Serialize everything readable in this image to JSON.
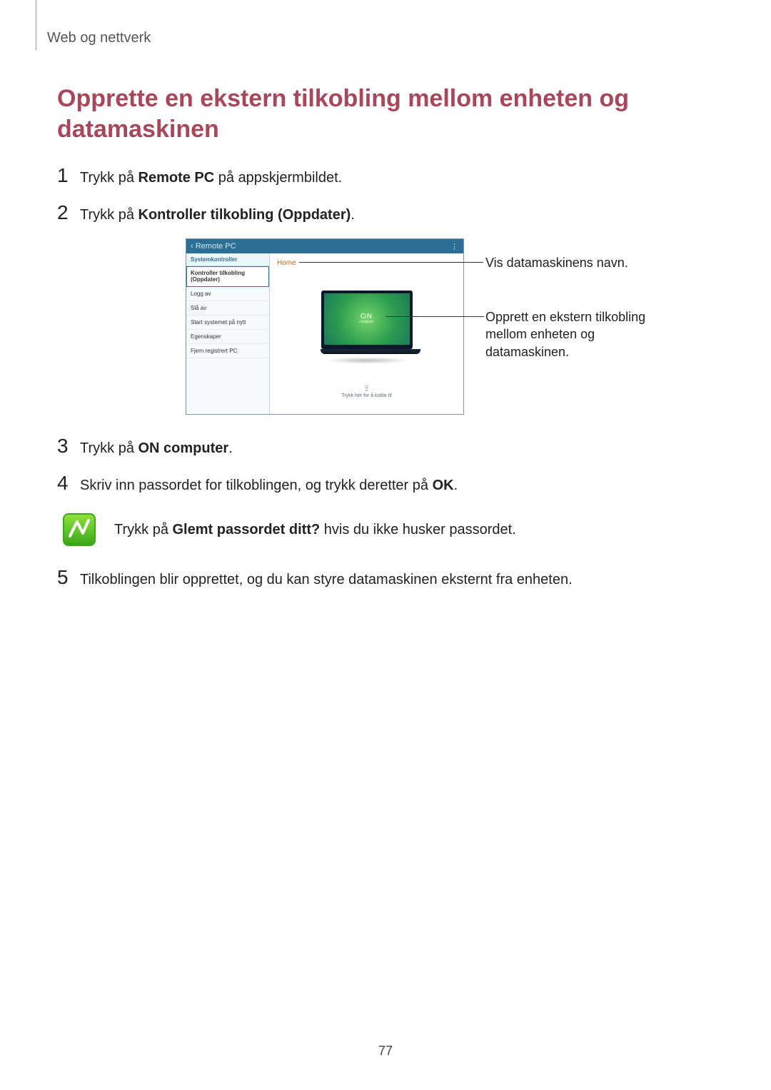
{
  "header": {
    "section": "Web og nettverk"
  },
  "title": "Opprette en ekstern tilkobling mellom enheten og datamaskinen",
  "steps": {
    "s1_pre": "Trykk på ",
    "s1_bold": "Remote PC",
    "s1_post": " på appskjermbildet.",
    "s2_pre": "Trykk på ",
    "s2_bold": "Kontroller tilkobling (Oppdater)",
    "s2_post": ".",
    "s3_pre": "Trykk på ",
    "s3_bold": "ON computer",
    "s3_post": ".",
    "s4_pre": "Skriv inn passordet for tilkoblingen, og trykk deretter på ",
    "s4_bold": "OK",
    "s4_post": ".",
    "s5": "Tilkoblingen blir opprettet, og du kan styre datamaskinen eksternt fra enheten."
  },
  "note": {
    "pre": "Trykk på ",
    "bold": "Glemt passordet ditt?",
    "post": " hvis du ikke husker passordet."
  },
  "figure": {
    "titlebar_back": "‹",
    "titlebar_title": "Remote PC",
    "titlebar_menu": "⋮",
    "sidebar_header": "Systemkontroller",
    "sidebar_items": [
      "Kontroller tilkobling (Oppdater)",
      "Logg av",
      "Slå av",
      "Start systemet på nytt",
      "Egenskaper",
      "Fjern registrert PC"
    ],
    "home_label": "Home",
    "on_label": "ON",
    "on_sub": "computer",
    "tap_hint": "Trykk her for å koble til"
  },
  "callouts": {
    "c1": "Vis datamaskinens navn.",
    "c2": "Opprett en ekstern tilkobling mellom enheten og datamaskinen."
  },
  "page_number": "77"
}
